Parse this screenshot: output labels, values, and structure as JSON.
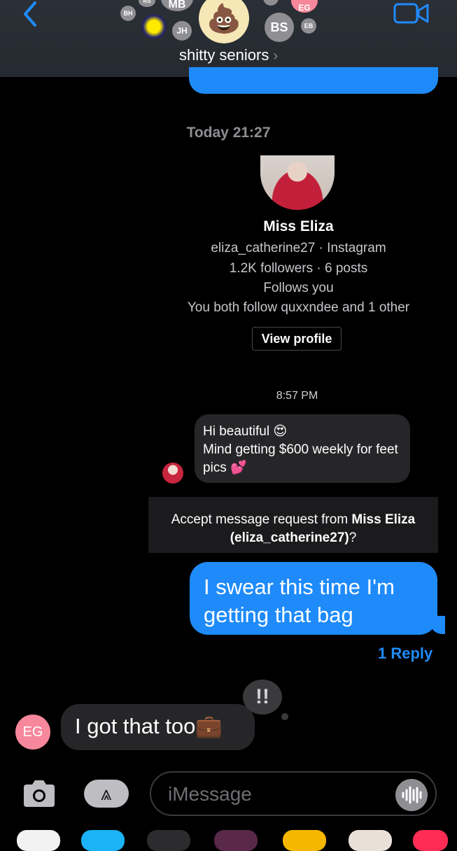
{
  "header": {
    "group_name": "shitty seniors",
    "avatars": [
      "BH",
      "RS",
      "MB",
      "JH",
      "BS",
      "EG",
      "EB"
    ],
    "center_avatar_icon": "poop-emoji-icon"
  },
  "top_message": {
    "text": ""
  },
  "thread": {
    "timestamp": "Today 21:27"
  },
  "profile_card": {
    "name": "Miss Eliza",
    "handle_line": "eliza_catherine27 · Instagram",
    "stats": "1.2K followers · 6 posts",
    "follows": "Follows you",
    "mutuals": "You both follow quxxndee and 1 other",
    "view_button": "View profile"
  },
  "request_time": "8:57 PM",
  "request_message": {
    "line1": "Hi beautiful 😍",
    "line2": "Mind getting $600 weekly for feet pics 💕"
  },
  "accept_bar": {
    "prefix": "Accept message request from ",
    "name": "Miss Eliza (eliza_catherine27)",
    "suffix": "?"
  },
  "outgoing": {
    "text": "I swear this time I'm getting that bag"
  },
  "reply_link": "1 Reply",
  "tapback": "!!",
  "incoming": {
    "sender_initials": "EG",
    "text": "I got that too💼"
  },
  "composer": {
    "placeholder": "iMessage"
  },
  "colors": {
    "accent": "#1f8bfa",
    "incoming_bubble": "#262629",
    "eg_avatar": "#f7889c"
  }
}
